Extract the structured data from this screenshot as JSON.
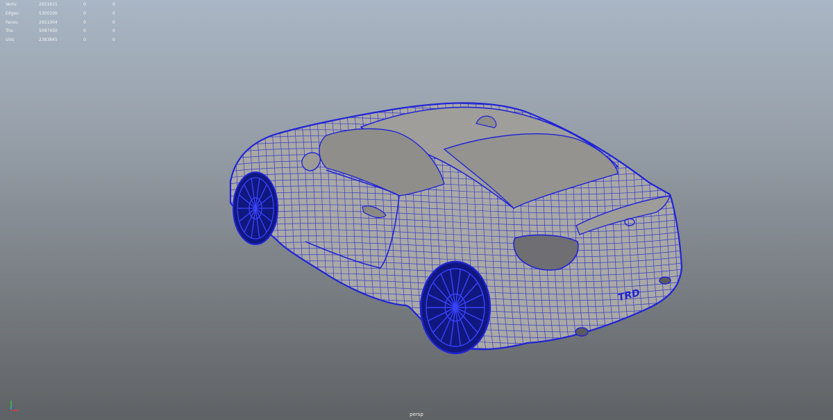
{
  "heads_up_display": {
    "rows": [
      {
        "label": "Verts:",
        "value": "2651615",
        "selected": "0",
        "percent": "0"
      },
      {
        "label": "Edges:",
        "value": "5300100",
        "selected": "0",
        "percent": "0"
      },
      {
        "label": "Faces:",
        "value": "2651004",
        "selected": "0",
        "percent": "0"
      },
      {
        "label": "Tris:",
        "value": "5097450",
        "selected": "0",
        "percent": "0"
      },
      {
        "label": "UVs:",
        "value": "2383845",
        "selected": "0",
        "percent": "0"
      }
    ]
  },
  "viewport": {
    "camera_label": "persp",
    "wireframe_color": "#1f23d6",
    "shaded_color": "#aaa9a6",
    "axis": {
      "x_color": "#e33b3b",
      "y_color": "#39c24a",
      "z_color": "#3a55e8"
    }
  }
}
